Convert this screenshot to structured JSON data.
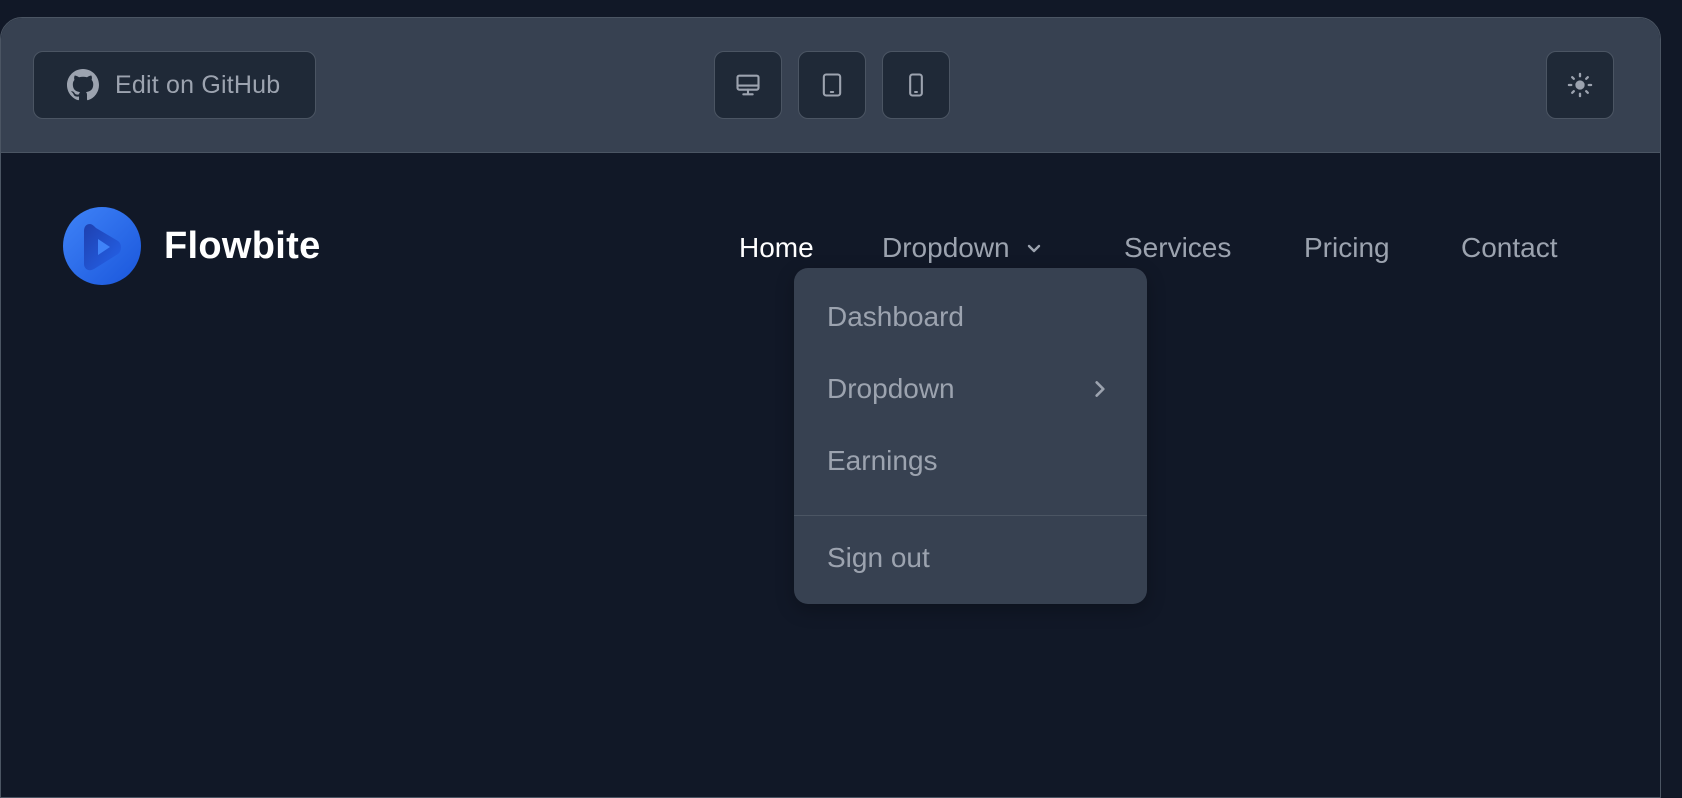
{
  "toolbar": {
    "github_label": "Edit on GitHub",
    "view_buttons": [
      {
        "icon": "desktop-icon"
      },
      {
        "icon": "tablet-icon"
      },
      {
        "icon": "mobile-icon"
      }
    ],
    "theme_icon": "sun-icon"
  },
  "brand": {
    "name": "Flowbite",
    "logo_icon": "flowbite-logo-icon"
  },
  "nav": {
    "items": [
      {
        "label": "Home",
        "active": true
      },
      {
        "label": "Dropdown",
        "has_chevron": true
      },
      {
        "label": "Services"
      },
      {
        "label": "Pricing"
      },
      {
        "label": "Contact"
      }
    ]
  },
  "dropdown": {
    "items": [
      {
        "label": "Dashboard"
      },
      {
        "label": "Dropdown",
        "has_submenu": true
      },
      {
        "label": "Earnings"
      }
    ],
    "footer_item": {
      "label": "Sign out"
    }
  },
  "colors": {
    "background": "#111827",
    "toolbar": "#374151",
    "button": "#1f2937",
    "border": "#4b5563",
    "text_muted": "#9ca3af",
    "text_active": "#ffffff",
    "brand_blue": "#1c64f2"
  }
}
